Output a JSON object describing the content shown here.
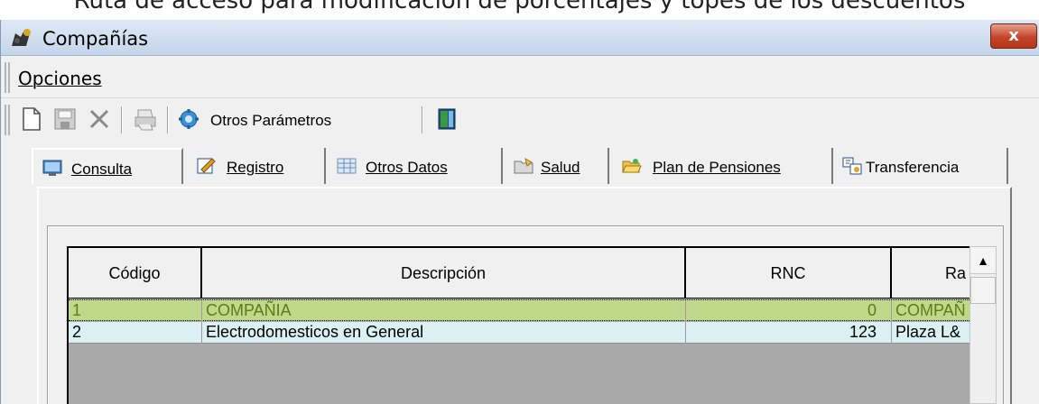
{
  "caption": "Ruta de acceso para modificación de porcentajes y topes de los descuentos",
  "window": {
    "title": "Compañías",
    "close_label": "x"
  },
  "menu": {
    "options_label": "Opciones"
  },
  "toolbar": {
    "other_params_label": "Otros Parámetros"
  },
  "tabs": [
    {
      "label": "Consulta"
    },
    {
      "label": "Registro"
    },
    {
      "label": "Otros Datos"
    },
    {
      "label": "Salud"
    },
    {
      "label": "Plan de Pensiones"
    },
    {
      "label": "Transferencia"
    }
  ],
  "grid": {
    "columns": [
      "Código",
      "Descripción",
      "RNC",
      "Ra"
    ],
    "rows": [
      {
        "code": "1",
        "description": "COMPAÑIA",
        "rnc": "0",
        "ra": "COMPAÑ"
      },
      {
        "code": "2",
        "description": "Electrodomesticos en General",
        "rnc": "123",
        "ra": "Plaza L&"
      }
    ]
  },
  "colors": {
    "selected_row": "#bfd88a",
    "alt_row": "#dbf0f2",
    "close_button": "#c5452c"
  }
}
